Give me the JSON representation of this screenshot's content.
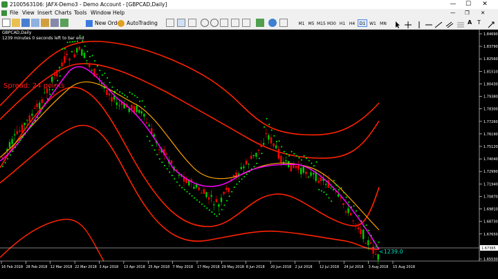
{
  "window": {
    "title": "2100563106: JAFX-Demo3 - Demo Account - [GBPCAD,Daily]",
    "min": "—",
    "max": "☐",
    "close": "✕"
  },
  "menu": [
    "File",
    "View",
    "Insert",
    "Charts",
    "Tools",
    "Window",
    "Help"
  ],
  "toolbar": {
    "new_order": "New Order",
    "autotrading": "AutoTrading",
    "timeframes": [
      "M1",
      "M5",
      "M15",
      "M30",
      "H1",
      "H4",
      "D1",
      "W1",
      "MN"
    ],
    "active_timeframe": "D1"
  },
  "chart": {
    "symbol_label": "GBPCAD,Daily",
    "info_label": "1239 minutes 0 seconds left to bar end",
    "spread_label": "Spread: 24 points",
    "timer_label": "<1239.0",
    "current_price": "1.67365",
    "price_ticks": [
      "1.84690",
      "1.83790",
      "1.82560",
      "1.81510",
      "1.80430",
      "1.79380",
      "1.78300",
      "1.77260",
      "1.76190",
      "1.75120",
      "1.74040",
      "1.72990",
      "1.71940",
      "1.70870",
      "1.69810",
      "1.68730",
      "1.67650",
      "1.66600",
      "1.65530"
    ],
    "date_ticks": [
      "16 Feb 2018",
      "28 Feb 2018",
      "12 Mar 2018",
      "22 Mar 2018",
      "3 Apr 2018",
      "13 Apr 2018",
      "25 Apr 2018",
      "7 May 2018",
      "17 May 2018",
      "29 May 2018",
      "8 Jun 2018",
      "20 Jun 2018",
      "2 Jul 2018",
      "12 Jul 2018",
      "24 Jul 2018",
      "3 Aug 2018",
      "15 Aug 2018"
    ],
    "colors": {
      "bull": "#00cc00",
      "bear": "#ff0000",
      "bands": "#ff2200",
      "ma_orange": "#ffa500",
      "ma_magenta": "#ff00ff",
      "psar": "#00ff00",
      "grid_text": "#ffffff"
    }
  }
}
